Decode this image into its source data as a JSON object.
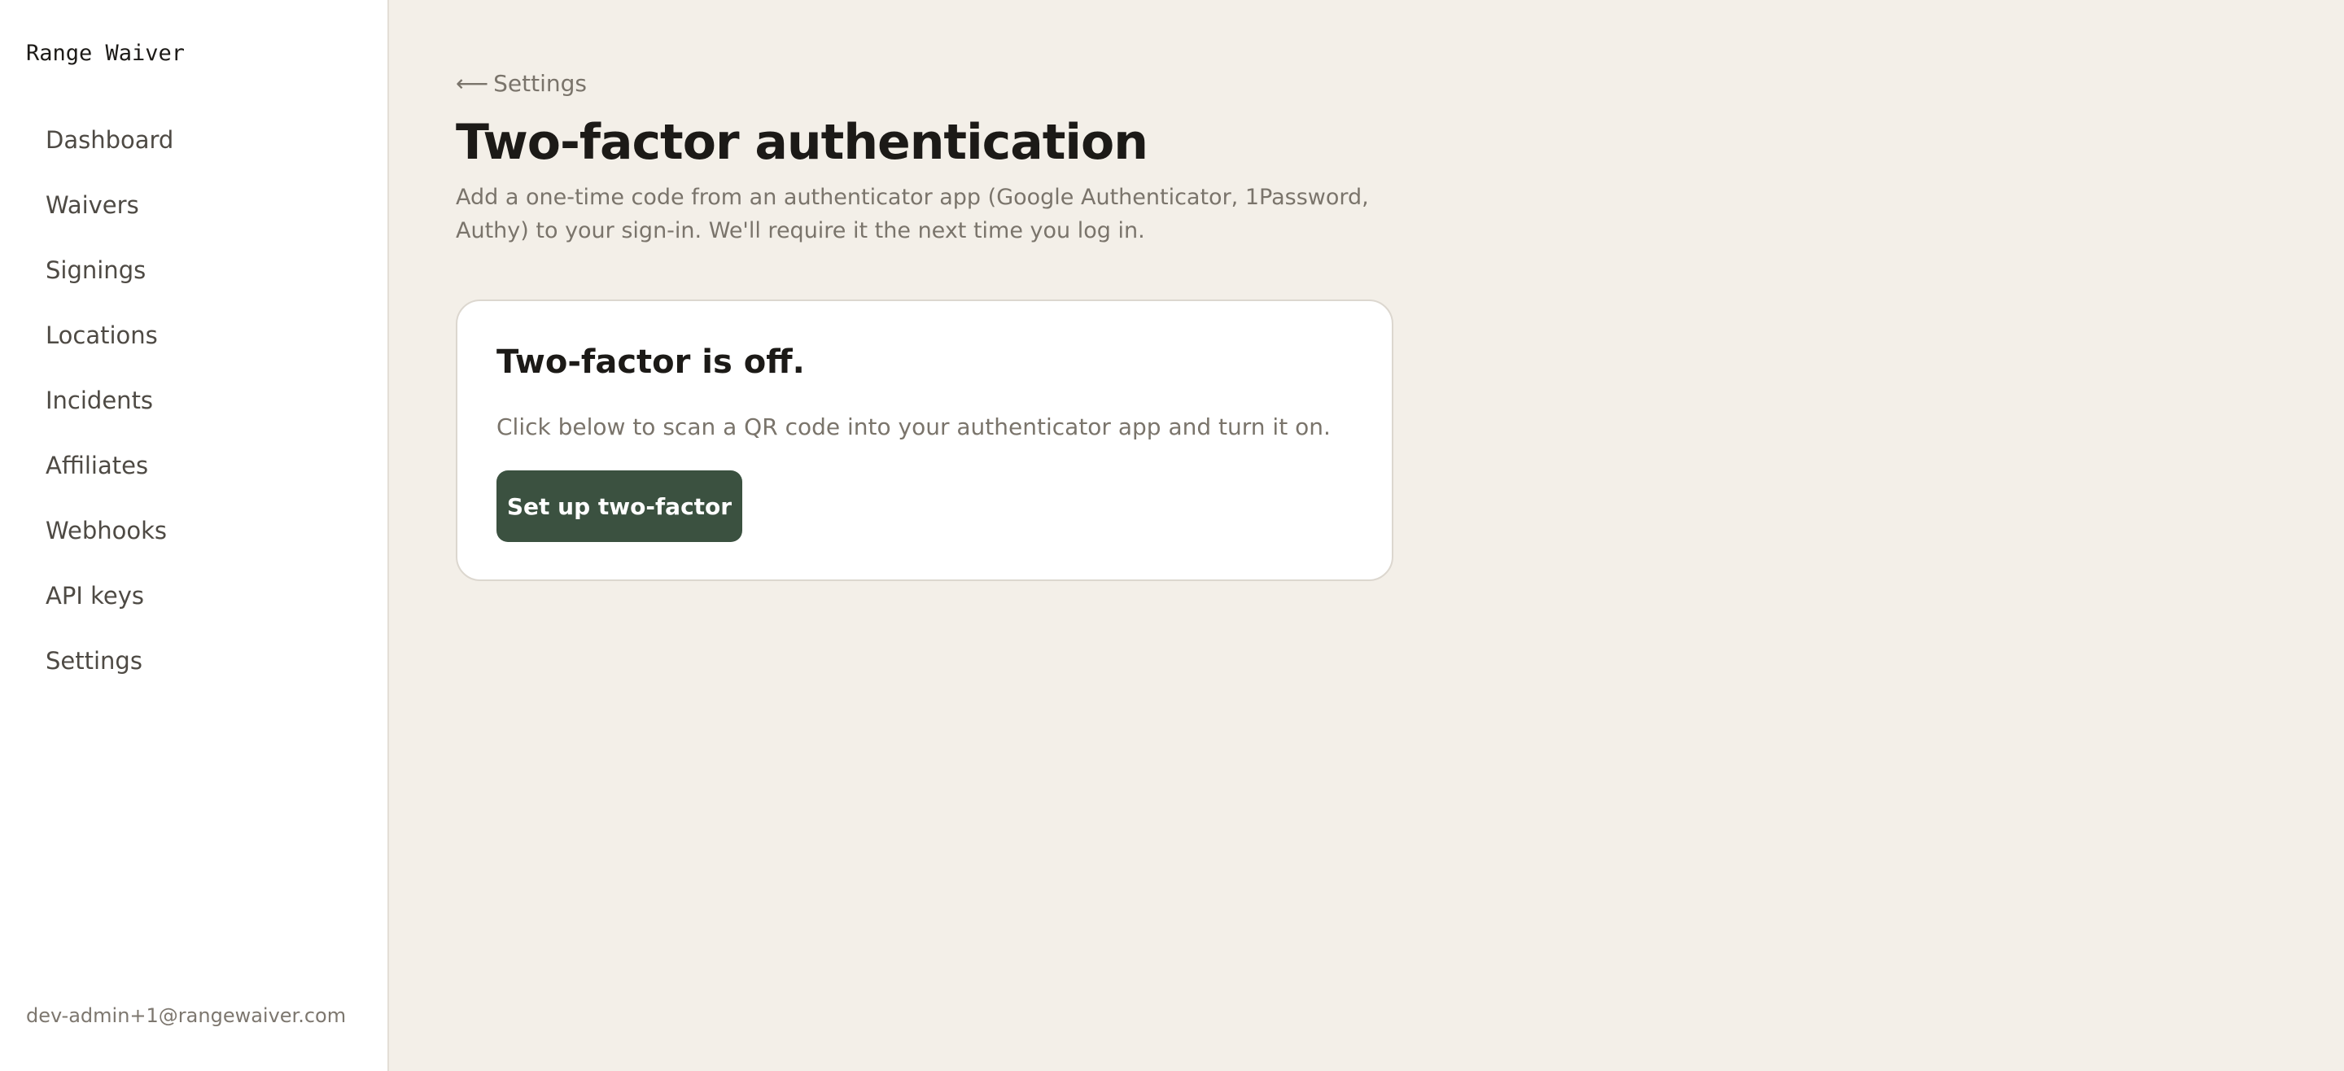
{
  "app": {
    "name": "Range Waiver"
  },
  "sidebar": {
    "items": [
      {
        "label": "Dashboard"
      },
      {
        "label": "Waivers"
      },
      {
        "label": "Signings"
      },
      {
        "label": "Locations"
      },
      {
        "label": "Incidents"
      },
      {
        "label": "Affiliates"
      },
      {
        "label": "Webhooks"
      },
      {
        "label": "API keys"
      },
      {
        "label": "Settings"
      }
    ],
    "user_email": "dev-admin+1@rangewaiver.com"
  },
  "breadcrumb": {
    "arrow": "⟵",
    "label": "Settings"
  },
  "page": {
    "title": "Two-factor authentication",
    "description": "Add a one-time code from an authenticator app (Google Authenticator, 1Password, Authy) to your sign-in. We'll require it the next time you log in."
  },
  "card": {
    "title": "Two-factor is off.",
    "text": "Click below to scan a QR code into your authenticator app and turn it on.",
    "button_label": "Set up two-factor"
  },
  "colors": {
    "background": "#f3efe8",
    "sidebar": "#ffffff",
    "primary_button": "#3b5140",
    "muted_text": "#7a746b"
  }
}
